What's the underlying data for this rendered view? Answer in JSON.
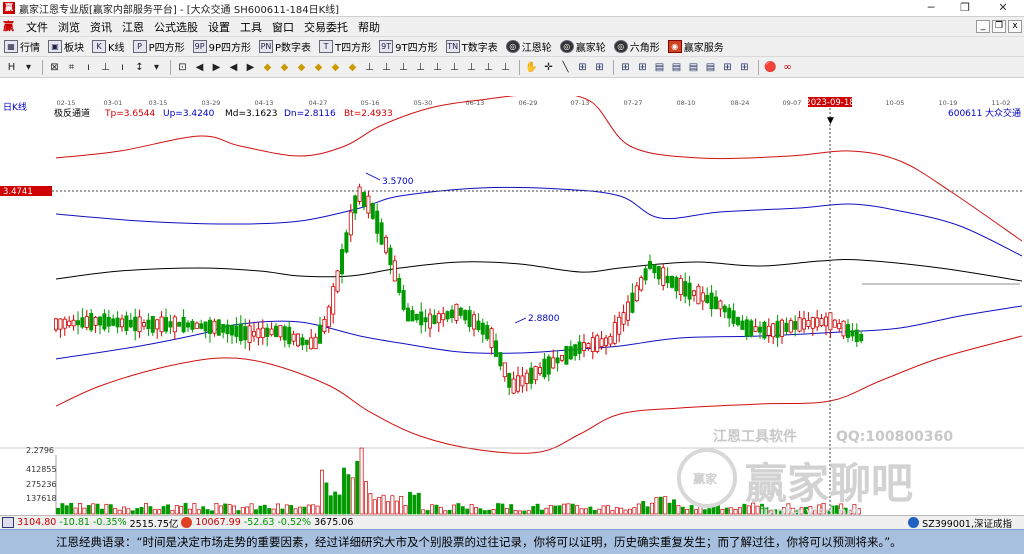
{
  "window": {
    "title": "赢家江恩专业版[赢家内部服务平台] - [大众交通  SH600611-184日K线]",
    "minimize": "─",
    "maximize": "❐",
    "close": "✕"
  },
  "menu": {
    "logo": "赢",
    "items": [
      "文件",
      "浏览",
      "资讯",
      "江恩",
      "公式选股",
      "设置",
      "工具",
      "窗口",
      "交易委托",
      "帮助"
    ],
    "mdi": [
      "_",
      "❐",
      "x"
    ]
  },
  "toolbar": {
    "buttons": [
      {
        "icon": "grid-icon",
        "glyph": "▦",
        "label": "行情"
      },
      {
        "icon": "board-icon",
        "glyph": "▣",
        "label": "板块"
      },
      {
        "icon": "kline-icon",
        "glyph": "K",
        "label": "K线"
      },
      {
        "icon": "p-square-icon",
        "glyph": "P",
        "label": "P四方形"
      },
      {
        "icon": "9p-square-icon",
        "glyph": "9P",
        "label": "9P四方形"
      },
      {
        "icon": "p-number-table-icon",
        "glyph": "PN",
        "label": "P数字表"
      },
      {
        "icon": "t-square-icon",
        "glyph": "T",
        "label": "T四方形"
      },
      {
        "icon": "9t-square-icon",
        "glyph": "9T",
        "label": "9T四方形"
      },
      {
        "icon": "t-number-table-icon",
        "glyph": "TN",
        "label": "T数字表"
      },
      {
        "icon": "gann-wheel-icon",
        "glyph": "◎",
        "label": "江恩轮"
      },
      {
        "icon": "winner-wheel-icon",
        "glyph": "◎",
        "label": "赢家轮"
      },
      {
        "icon": "hexagon-icon",
        "glyph": "◎",
        "label": "六角形"
      },
      {
        "icon": "service-icon",
        "glyph": "◉",
        "label": "赢家服务"
      }
    ]
  },
  "drawing_tools": [
    "H",
    "▾",
    "⊠",
    "⌗",
    "ı",
    "⊥",
    "ı",
    "↕",
    "▾",
    "⊡",
    "◀",
    "▶",
    "◀",
    "▶",
    "◆",
    "◆",
    "◆",
    "◆",
    "◆",
    "◆",
    "⊥",
    "⊥",
    "⊥",
    "⊥",
    "⊥",
    "⊥",
    "⊥",
    "⊥",
    "⊥",
    "✋",
    "✛",
    "╲",
    "⊞",
    "⊞",
    "⊞",
    "⊞",
    "▤",
    "▤",
    "▤",
    "▤",
    "⊞",
    "⊞",
    "🔴",
    "∞"
  ],
  "chart": {
    "period_label": "日K线",
    "indicator_name": "极反通道",
    "params": {
      "tp": "Tp=3.6544",
      "up": "Up=3.4240",
      "md": "Md=3.1623",
      "dn": "Dn=2.8116",
      "bt": "Bt=2.4933"
    },
    "code_label": "600611",
    "stock_name": "大众交通",
    "dates": [
      "02-15",
      "03-01",
      "03-15",
      "03-29",
      "04-13",
      "04-27",
      "05-16",
      "05-30",
      "06-13",
      "06-29",
      "07-13",
      "07-27",
      "08-10",
      "08-24",
      "09-07",
      "2023-09-18",
      "10-05",
      "10-19",
      "11-02"
    ],
    "cursor_date_index": 15,
    "cursor_price": "3.4741",
    "high_label": "3.5700",
    "low_label": "2.8800",
    "volume_axis": {
      "top": "2.2796",
      "ticks": [
        "412855",
        "275236",
        "137618"
      ]
    },
    "watermark": {
      "line1": "江恩工具软件",
      "qq": "QQ:100800360",
      "brand": "赢家聊吧",
      "url": "jiaoba.yjsd.net",
      "badge": "赢家"
    }
  },
  "status": {
    "sh_index": "3104.80",
    "sh_change": "-10.81",
    "sh_pct": "-0.35%",
    "sh_volume": "2515.75亿",
    "sz_index": "10067.99",
    "sz_change": "-52.63",
    "sz_pct": "-0.52%",
    "sz_volume": "3675.06",
    "right_text": "SZ399001,深证成指"
  },
  "quote": "江恩经典语录：“时间是决定市场走势的重要因素，经过详细研究大市及个别股票的过往记录，你将可以证明，历史确实重复发生；而了解过往，你将可以预测将来。”。",
  "colors": {
    "up": "#d00000",
    "down": "#009900",
    "band_outer": "#d01010",
    "band_inner": "#1010c0",
    "mid": "#000000",
    "cursor_tag": "#d00000"
  }
}
